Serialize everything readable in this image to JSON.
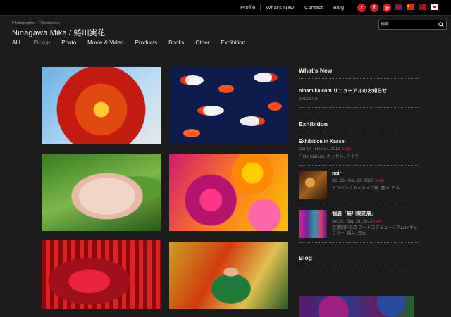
{
  "topnav": [
    "Profile",
    "What's New",
    "Contact",
    "Blog"
  ],
  "social": [
    {
      "name": "twitter-icon",
      "glyph": "t"
    },
    {
      "name": "facebook-icon",
      "glyph": "f"
    },
    {
      "name": "instagram-icon",
      "glyph": "◎"
    }
  ],
  "header": {
    "subtitle": "Photographer / Film director",
    "logo": "Ninagawa Mika / 蜷川実花"
  },
  "search": {
    "placeholder": "検索"
  },
  "categories": [
    "ALL",
    "Pickup",
    "Photo",
    "Movie & Video",
    "Products",
    "Books",
    "Other",
    "Exhibition"
  ],
  "active_category": "Pickup",
  "whatsnew": {
    "heading": "What's New",
    "items": [
      {
        "title": "ninamika.com リニューアルのお知らせ",
        "date": "2013/9/18"
      }
    ]
  },
  "exhibition": {
    "heading": "Exhibition",
    "items": [
      {
        "title": "Exhibition in Kassel",
        "date": "Oct 17 - Nov 07, 2013",
        "status": "Soon",
        "venue": "Fridericianum, カッセル, ドイツ"
      },
      {
        "title": "noir",
        "date": "Oct 26 - Dec 23, 2013",
        "status": "Soon",
        "venue": "ミユゼふくおかカメラ館, 富山, 日本"
      },
      {
        "title": "個展「蜷川実花展」",
        "date": "Jul 20 - Sep 29, 2013",
        "status": "Now",
        "venue": "金津創作の森 アートコアミュージアム1+ギャラリー, 福井, 日本"
      }
    ]
  },
  "blog": {
    "heading": "Blog"
  },
  "colors": {
    "accent": "#e02040",
    "background": "#1c1c1c",
    "topbar": "#000000"
  }
}
